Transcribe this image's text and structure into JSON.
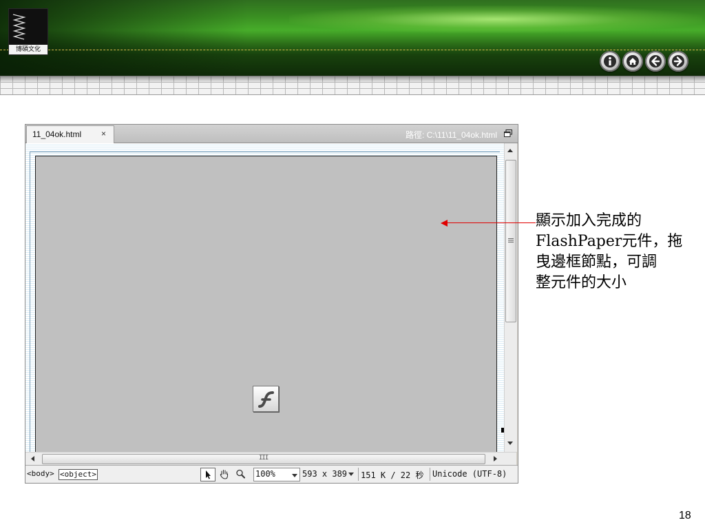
{
  "header": {
    "logo_text": "博碩文化"
  },
  "nav_buttons": [
    {
      "name": "info",
      "icon": "info-icon"
    },
    {
      "name": "home",
      "icon": "home-icon"
    },
    {
      "name": "back",
      "icon": "arrow-left-icon"
    },
    {
      "name": "forward",
      "icon": "arrow-right-icon"
    }
  ],
  "document": {
    "tab_label": "11_04ok.html",
    "tab_close": "×",
    "path_label": "路徑:  C:\\11\\11_04ok.html"
  },
  "hscroll": {
    "grip": "III"
  },
  "statusbar": {
    "tags": [
      "<body>",
      "<object>"
    ],
    "zoom": "100%",
    "window_size": "593 x 389",
    "download": "151 K / 22 秒",
    "encoding": "Unicode (UTF-8)"
  },
  "callout": {
    "lines": [
      "顯示加入完成的",
      "FlashPaper元件，拖",
      "曳邊框節點，可調",
      "整元件的大小"
    ],
    "arrow_color": "#e00000"
  },
  "slide": {
    "page_number": "18"
  },
  "colors": {
    "banner_green": "#47ad2a",
    "flash_object_bg": "#c0c0c0"
  }
}
